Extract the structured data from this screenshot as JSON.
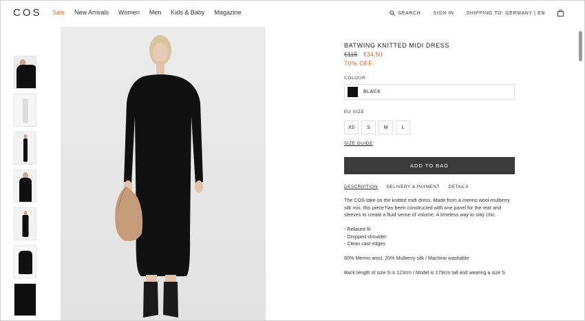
{
  "header": {
    "logo": "COS",
    "nav": [
      "Sale",
      "New Arrivals",
      "Women",
      "Men",
      "Kids & Baby",
      "Magazine"
    ],
    "search_label": "SEARCH",
    "signin_label": "SIGN IN",
    "shipping_label": "SHIPPING TO: GERMANY | EN"
  },
  "product": {
    "title": "BATWING KNITTED MIDI DRESS",
    "old_price": "€115",
    "new_price": "€34.50",
    "discount": "70% OFF",
    "colour_label": "COLOUR",
    "colour_name": "BLACK",
    "colour_hex": "#111111",
    "size_label": "EU SIZE",
    "sizes": [
      "XS",
      "S",
      "M",
      "L"
    ],
    "size_guide": "SIZE GUIDE",
    "add_to_bag": "ADD TO BAG",
    "tabs": [
      "DESCRIPTION",
      "DELIVERY & PAYMENT",
      "DETAILS"
    ],
    "description": "The COS take on the knitted midi dress. Made from a merino wool-mulberry silk mix, this piece has been constructed with one panel for the rear and sleeves to create a fluid sense of volume. A timeless way to stay chic.",
    "features": [
      "- Relaxed fit",
      "- Dropped shoulder",
      "- Clean cast edges"
    ],
    "composition": "80% Merino wool, 20% Mulberry silk / Machine washable",
    "fit_note": "Back length of size S is 123cm / Model is 179cm tall and wearing a size S"
  },
  "colors": {
    "accent": "#d1672f",
    "button_bg": "#3b3b3b"
  }
}
